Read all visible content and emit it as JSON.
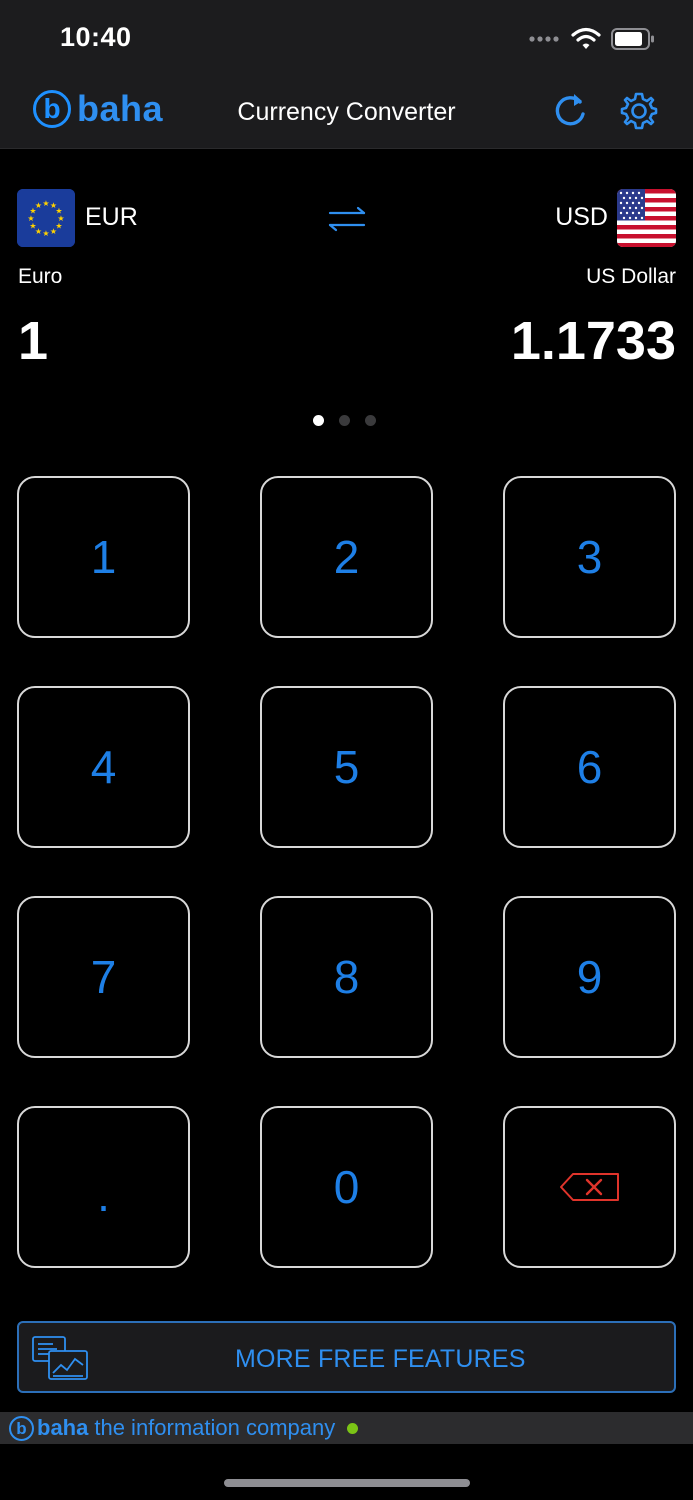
{
  "status_bar": {
    "time": "10:40",
    "icons": [
      "cellular-icon",
      "wifi-icon",
      "battery-icon"
    ]
  },
  "nav": {
    "brand_letter": "b",
    "brand_name": "baha",
    "title": "Currency Converter",
    "icons": [
      "refresh-icon",
      "gear-icon"
    ]
  },
  "converter": {
    "from": {
      "code": "EUR",
      "name": "Euro",
      "amount": "1",
      "flag": "eu-flag-icon"
    },
    "to": {
      "code": "USD",
      "name": "US Dollar",
      "amount": "1.1733",
      "flag": "us-flag-icon"
    },
    "swap_icon": "swap-arrows-icon"
  },
  "pagination": {
    "pages": 3,
    "active_page": 1
  },
  "keypad": {
    "keys": [
      "1",
      "2",
      "3",
      "4",
      "5",
      "6",
      "7",
      "8",
      "9",
      ".",
      "0"
    ],
    "backspace_icon": "backspace-icon"
  },
  "features_button": {
    "label": "MORE FREE FEATURES",
    "icon": "chart-screens-icon"
  },
  "footer": {
    "brand_letter": "b",
    "brand_name": "baha",
    "tagline": "the information company"
  },
  "colors": {
    "accent": "#1e7fe6",
    "background": "#000000",
    "bar": "#1c1c1e",
    "backspace": "#e0342b",
    "status_dot": "#7bc416"
  }
}
